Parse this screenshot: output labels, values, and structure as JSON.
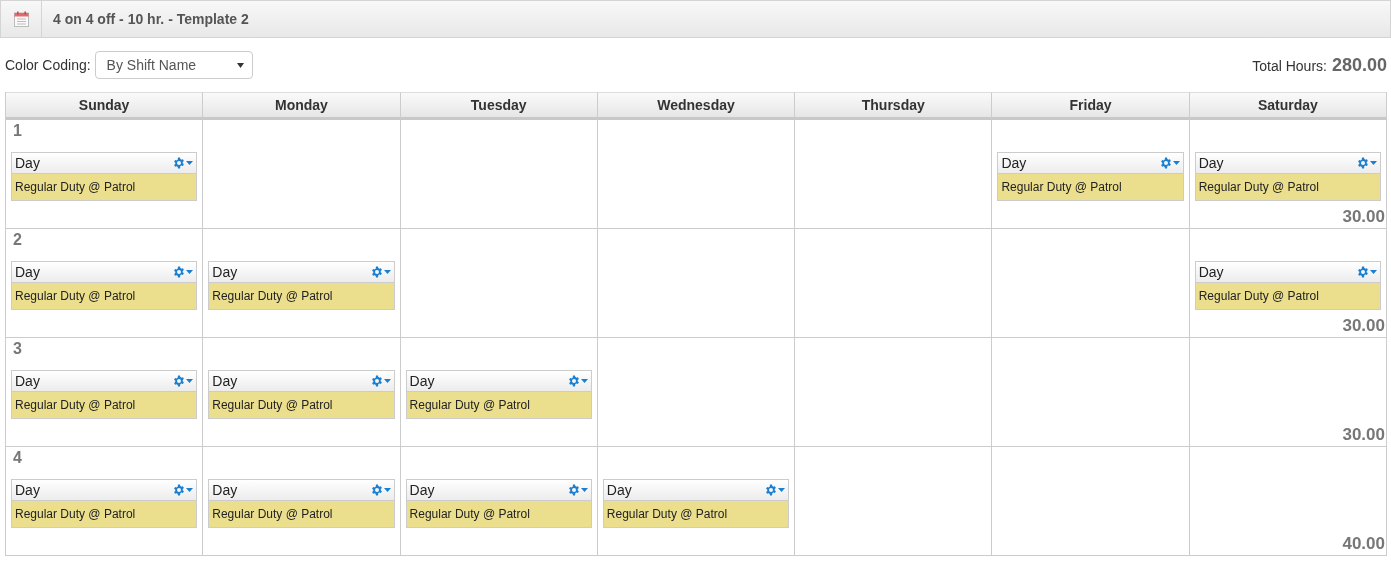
{
  "header": {
    "title": "4 on 4 off - 10 hr. - Template 2"
  },
  "color_coding": {
    "label": "Color Coding:",
    "value": "By Shift Name"
  },
  "total_hours": {
    "label": "Total Hours:",
    "value": "280.00"
  },
  "days": [
    "Sunday",
    "Monday",
    "Tuesday",
    "Wednesday",
    "Thursday",
    "Friday",
    "Saturday"
  ],
  "weeks": [
    {
      "number": "1",
      "total": "30.00",
      "days": [
        {
          "kind": "shift",
          "name": "Day",
          "description": "Regular Duty @ Patrol",
          "color": "#ebdf8d"
        },
        {
          "kind": "off"
        },
        {
          "kind": "off"
        },
        {
          "kind": "off"
        },
        {
          "kind": "off"
        },
        {
          "kind": "shift",
          "name": "Day",
          "description": "Regular Duty @ Patrol",
          "color": "#ebdf8d"
        },
        {
          "kind": "shift",
          "name": "Day",
          "description": "Regular Duty @ Patrol",
          "color": "#ebdf8d"
        }
      ]
    },
    {
      "number": "2",
      "total": "30.00",
      "days": [
        {
          "kind": "shift",
          "name": "Day",
          "description": "Regular Duty @ Patrol",
          "color": "#ebdf8d"
        },
        {
          "kind": "shift",
          "name": "Day",
          "description": "Regular Duty @ Patrol",
          "color": "#ebdf8d"
        },
        {
          "kind": "off"
        },
        {
          "kind": "off"
        },
        {
          "kind": "off"
        },
        {
          "kind": "off"
        },
        {
          "kind": "shift",
          "name": "Day",
          "description": "Regular Duty @ Patrol",
          "color": "#ebdf8d"
        }
      ]
    },
    {
      "number": "3",
      "total": "30.00",
      "days": [
        {
          "kind": "shift",
          "name": "Day",
          "description": "Regular Duty @ Patrol",
          "color": "#ebdf8d"
        },
        {
          "kind": "shift",
          "name": "Day",
          "description": "Regular Duty @ Patrol",
          "color": "#ebdf8d"
        },
        {
          "kind": "shift",
          "name": "Day",
          "description": "Regular Duty @ Patrol",
          "color": "#ebdf8d"
        },
        {
          "kind": "off"
        },
        {
          "kind": "off"
        },
        {
          "kind": "off"
        },
        {
          "kind": "off"
        }
      ]
    },
    {
      "number": "4",
      "total": "40.00",
      "days": [
        {
          "kind": "shift",
          "name": "Day",
          "description": "Regular Duty @ Patrol",
          "color": "#ebdf8d"
        },
        {
          "kind": "shift",
          "name": "Day",
          "description": "Regular Duty @ Patrol",
          "color": "#ebdf8d"
        },
        {
          "kind": "shift",
          "name": "Day",
          "description": "Regular Duty @ Patrol",
          "color": "#ebdf8d"
        },
        {
          "kind": "shift",
          "name": "Day",
          "description": "Regular Duty @ Patrol",
          "color": "#ebdf8d"
        },
        {
          "kind": "off"
        },
        {
          "kind": "off"
        },
        {
          "kind": "off"
        }
      ]
    }
  ]
}
